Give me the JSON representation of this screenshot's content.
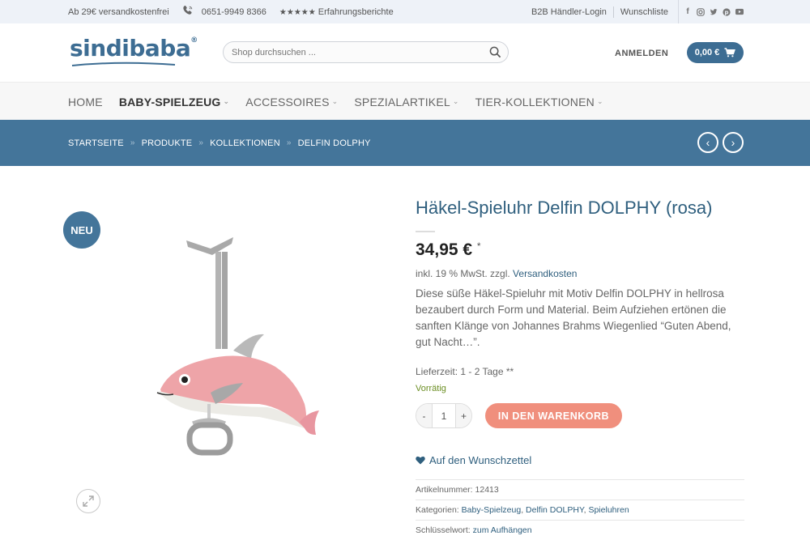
{
  "topbar": {
    "shipping": "Ab 29€ versandkostenfrei",
    "phone": "0651-9949 8366",
    "stars": "★★★★★",
    "reviews": "Erfahrungsberichte",
    "b2b": "B2B Händler-Login",
    "wishlist": "Wunschliste",
    "social_icons": [
      "facebook-icon",
      "instagram-icon",
      "twitter-icon",
      "pinterest-icon",
      "youtube-icon"
    ]
  },
  "header": {
    "logo": "sindibaba",
    "logo_mark": "®",
    "search_placeholder": "Shop durchsuchen ...",
    "login": "ANMELDEN",
    "cart_total": "0,00 €"
  },
  "nav": {
    "items": [
      {
        "label": "HOME",
        "has_menu": false
      },
      {
        "label": "BABY-SPIELZEUG",
        "has_menu": true,
        "active": true
      },
      {
        "label": "ACCESSOIRES",
        "has_menu": true
      },
      {
        "label": "SPEZIALARTIKEL",
        "has_menu": true
      },
      {
        "label": "TIER-KOLLEKTIONEN",
        "has_menu": true
      }
    ]
  },
  "breadcrumb": {
    "items": [
      "STARTSEITE",
      "PRODUKTE",
      "KOLLEKTIONEN",
      "DELFIN DOLPHY"
    ],
    "separator": "»",
    "prev": "‹",
    "next": "›"
  },
  "product": {
    "badge": "NEU",
    "title": "Häkel-Spieluhr Delfin DOLPHY (rosa)",
    "price": "34,95 €",
    "price_note": "*",
    "tax_prefix": "inkl. 19 % MwSt. zzgl.",
    "tax_link": "Versandkosten",
    "description": "Diese süße Häkel-Spieluhr mit Motiv Delfin DOLPHY in hellrosa bezaubert durch Form und Material. Beim Aufziehen ertönen die sanften Klänge von Johannes Brahms Wiegenlied “Guten Abend, gut Nacht…”.",
    "delivery": "Lieferzeit: 1 - 2 Tage **",
    "stock": "Vorrätig",
    "qty_minus": "-",
    "qty_value": "1",
    "qty_plus": "+",
    "add_to_cart": "IN DEN WARENKORB",
    "wishlist": "Auf den Wunschzettel",
    "sku_label": "Artikelnummer:",
    "sku": "12413",
    "categories_label": "Kategorien:",
    "categories": [
      "Baby-Spielzeug",
      "Delfin DOLPHY",
      "Spieluhren"
    ],
    "keyword_label": "Schlüsselwort:",
    "keyword": "zum Aufhängen"
  },
  "colors": {
    "brand_blue": "#44759a",
    "title_blue": "#2f5f7e",
    "cart_button": "#f08f7d",
    "stock_green": "#6b8e23"
  }
}
